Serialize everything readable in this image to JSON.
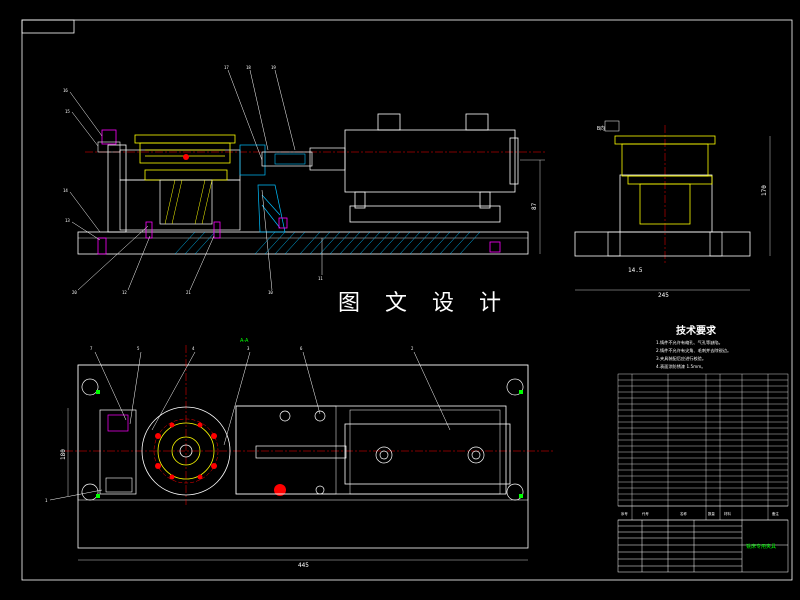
{
  "watermark": "图 文 设 计",
  "section_label": "A-A",
  "technical_requirements": {
    "title": "技术要求",
    "notes": [
      "1.铸件不允许有缩孔、气孔等缺陷。",
      "2.铸件不允许有尖角、毛刺并去除锐边。",
      "3.夹具装配后应进行校验。",
      "4.表面涂防锈漆 1.5mm。"
    ]
  },
  "balloons_front": [
    "16",
    "15",
    "17",
    "18",
    "19",
    "14",
    "13",
    "20",
    "12",
    "21",
    "10",
    "11"
  ],
  "balloons_top": [
    "7",
    "5",
    "4",
    "3",
    "6",
    "2",
    "1"
  ],
  "dimensions": {
    "front_height": "87",
    "side_height": "170",
    "side_width": "245",
    "side_small": "14.5",
    "top_height": "180",
    "top_width": "445",
    "side_label": "B向"
  },
  "title_block": {
    "drawing_name": "铣床专用夹具",
    "header_cells": [
      "序号",
      "代号",
      "名称",
      "数量",
      "材料",
      "备注"
    ]
  },
  "colors": {
    "outline": "#ffffff",
    "centerline": "#ff0000",
    "hatch": "#00bfff",
    "leader": "#ffffff",
    "accent": "#00ff00",
    "fastener": "#ff00ff",
    "body": "#ffff00"
  }
}
